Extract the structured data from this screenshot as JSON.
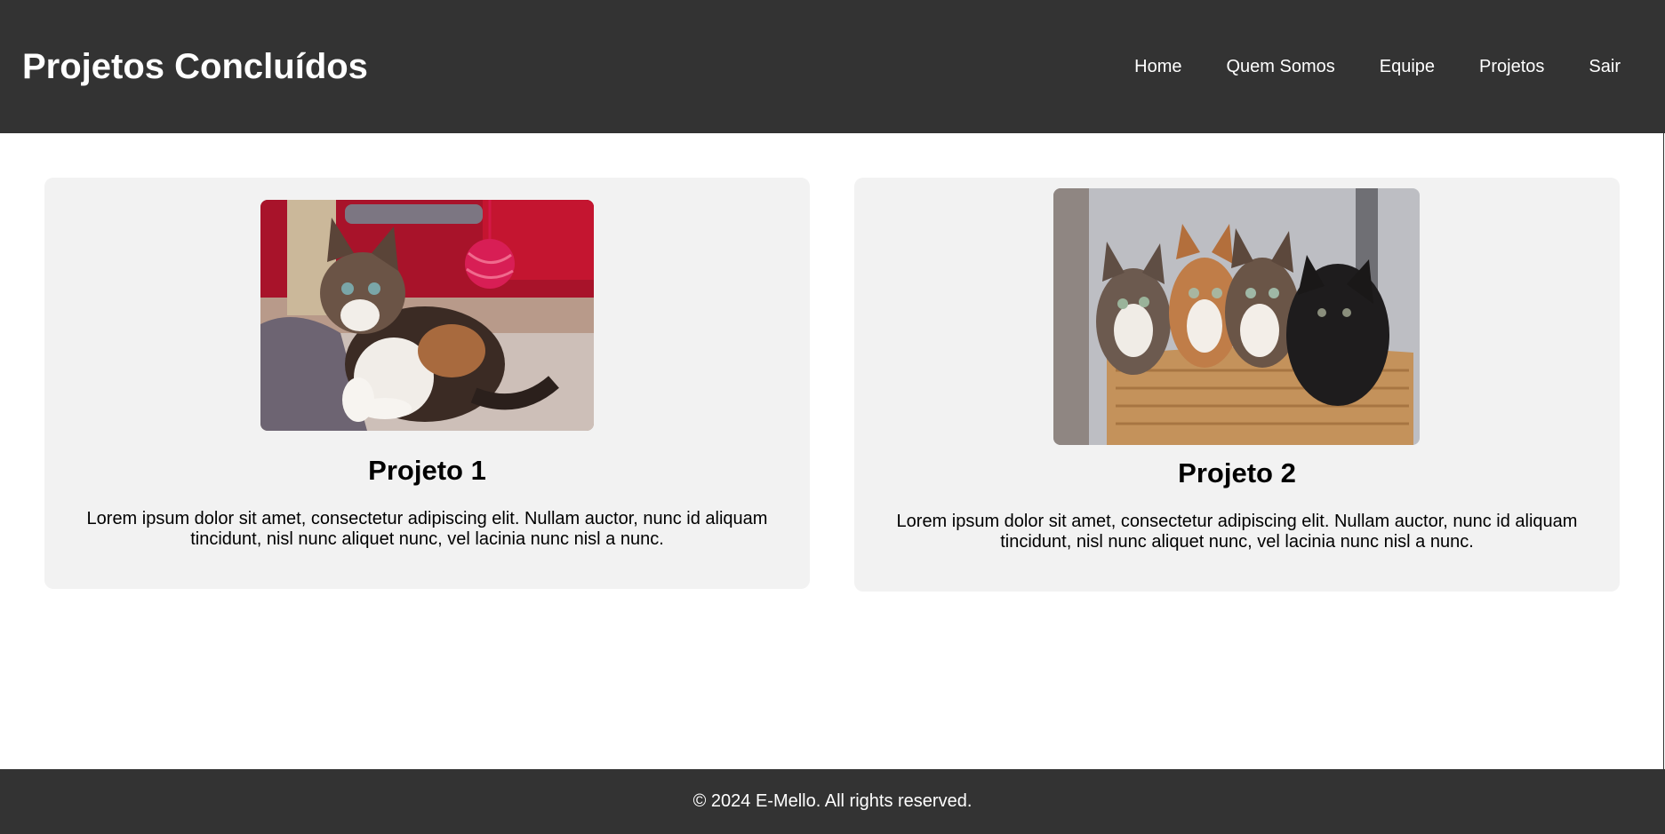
{
  "header": {
    "title": "Projetos Concluídos",
    "nav": [
      "Home",
      "Quem Somos",
      "Equipe",
      "Projetos",
      "Sair"
    ]
  },
  "projects": [
    {
      "title": "Projeto 1",
      "description": "Lorem ipsum dolor sit amet, consectetur adipiscing elit. Nullam auctor, nunc id aliquam tincidunt, nisl nunc aliquet nunc, vel lacinia nunc nisl a nunc."
    },
    {
      "title": "Projeto 2",
      "description": "Lorem ipsum dolor sit amet, consectetur adipiscing elit. Nullam auctor, nunc id aliquam tincidunt, nisl nunc aliquet nunc, vel lacinia nunc nisl a nunc."
    }
  ],
  "footer": {
    "text": "© 2024 E-Mello. All rights reserved."
  },
  "colors": {
    "header_bg": "#333333",
    "card_bg": "#f2f2f2",
    "text": "#000000",
    "header_text": "#ffffff"
  }
}
